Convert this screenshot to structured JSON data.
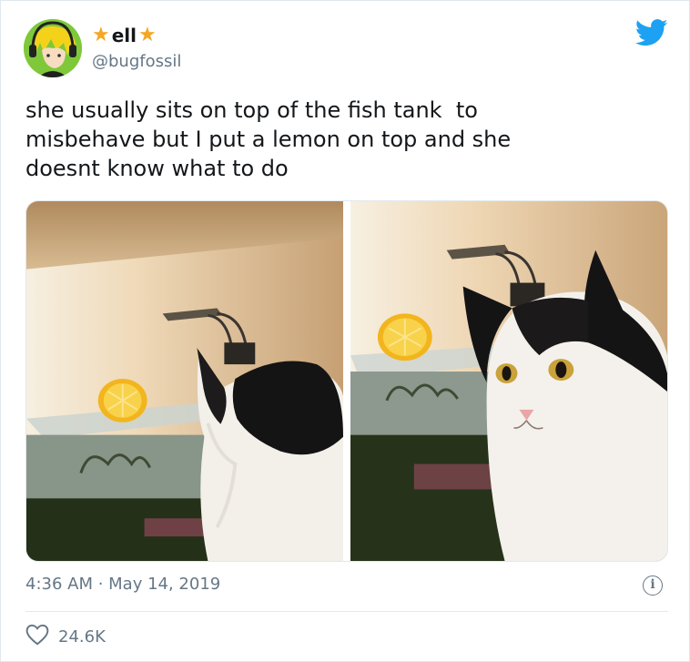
{
  "user": {
    "display_name": "ell",
    "handle": "@bugfossil"
  },
  "tweet": {
    "text": "she usually sits on top of the fish tank  to\nmisbehave but I put a lemon on top and she\ndoesnt know what to do",
    "timestamp": "4:36 AM · May 14, 2019",
    "likes": "24.6K"
  },
  "icons": {
    "brand": "twitter-bird-icon",
    "name_decoration": "star-icon",
    "info": "info-icon",
    "like": "heart-icon"
  },
  "colors": {
    "twitter_blue": "#1da1f2",
    "star": "#f5a623",
    "secondary_text": "#657786"
  }
}
